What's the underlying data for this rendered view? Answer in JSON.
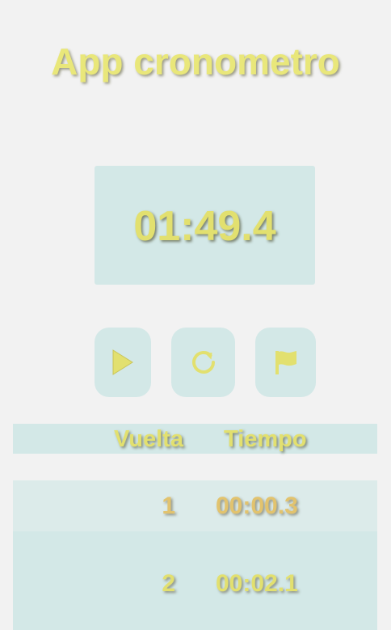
{
  "app": {
    "title": "App cronometro"
  },
  "display": {
    "time": "01:49.4"
  },
  "controls": {
    "play_icon": "play-icon",
    "reset_icon": "reset-icon",
    "lap_icon": "flag-icon"
  },
  "laps_table": {
    "headers": [
      "Vuelta",
      "Tiempo"
    ],
    "rows": [
      {
        "lap": "1",
        "time": "00:00.3"
      },
      {
        "lap": "2",
        "time": "00:02.1"
      }
    ]
  },
  "colors": {
    "background": "#f2f2f2",
    "panel": "#d3e8e7",
    "accent_text": "#e2e06f",
    "highlight_row_text": "#e2c36e"
  }
}
